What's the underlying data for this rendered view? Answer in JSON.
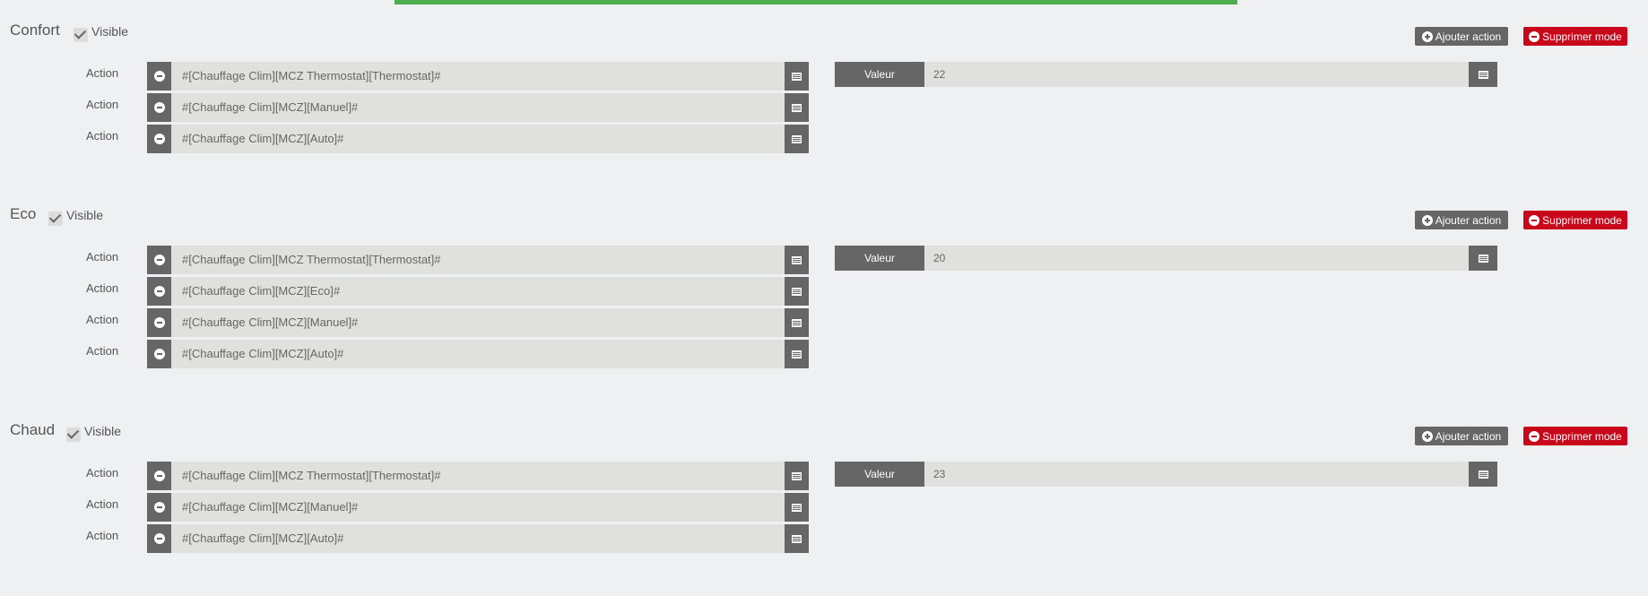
{
  "modes": [
    {
      "name": "Confort",
      "visible_label": "Visible",
      "add_action_label": "Ajouter action",
      "delete_mode_label": "Supprimer mode",
      "actions": [
        {
          "label": "Action",
          "command": "#[Chauffage  Clim][MCZ Thermostat][Thermostat]#",
          "value_label": "Valeur",
          "value": "22"
        },
        {
          "label": "Action",
          "command": "#[Chauffage Clim][MCZ][Manuel]#"
        },
        {
          "label": "Action",
          "command": "#[Chauffage Clim][MCZ][Auto]#"
        }
      ]
    },
    {
      "name": "Eco",
      "visible_label": "Visible",
      "add_action_label": "Ajouter action",
      "delete_mode_label": "Supprimer mode",
      "actions": [
        {
          "label": "Action",
          "command": "#[Chauffage  Clim][MCZ Thermostat][Thermostat]#",
          "value_label": "Valeur",
          "value": "20"
        },
        {
          "label": "Action",
          "command": "#[Chauffage Clim][MCZ][Eco]#"
        },
        {
          "label": "Action",
          "command": "#[Chauffage Clim][MCZ][Manuel]#"
        },
        {
          "label": "Action",
          "command": "#[Chauffage Clim][MCZ][Auto]#"
        }
      ]
    },
    {
      "name": "Chaud",
      "visible_label": "Visible",
      "add_action_label": "Ajouter action",
      "delete_mode_label": "Supprimer mode",
      "actions": [
        {
          "label": "Action",
          "command": "#[Chauffage  Clim][MCZ Thermostat][Thermostat]#",
          "value_label": "Valeur",
          "value": "23"
        },
        {
          "label": "Action",
          "command": "#[Chauffage Clim][MCZ][Manuel]#"
        },
        {
          "label": "Action",
          "command": "#[Chauffage Clim][MCZ][Auto]#"
        }
      ]
    }
  ],
  "colors": {
    "progress": "#4cae4c",
    "danger": "#c9071b",
    "button": "#666666",
    "input_bg": "#e0e1df",
    "page_bg": "#eff0f2"
  },
  "icons": {
    "add": "plus-circle-icon",
    "remove": "minus-circle-icon",
    "list": "list-icon",
    "check": "checkmark-icon"
  }
}
